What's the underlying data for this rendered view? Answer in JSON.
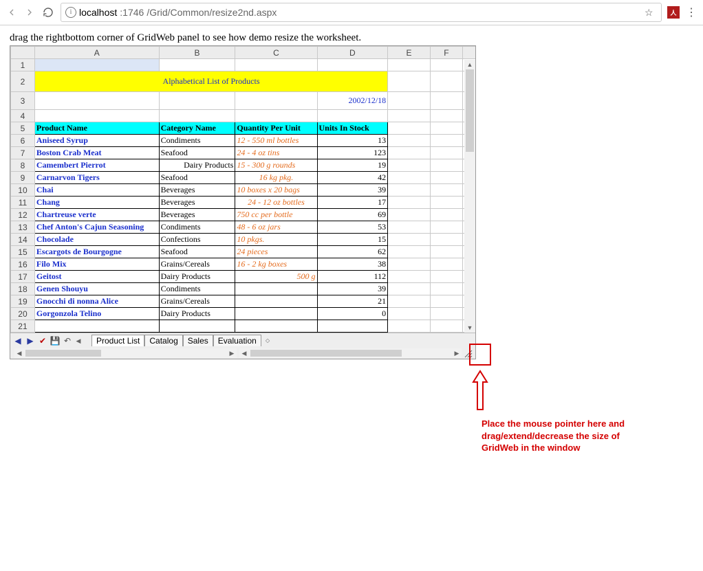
{
  "browser": {
    "url_host": "localhost",
    "url_port": ":1746",
    "url_path": "/Grid/Common/resize2nd.aspx",
    "pdf_label": "人"
  },
  "intro": "drag the rightbottom corner of GridWeb panel to see how demo resize the worksheet.",
  "cols": [
    "A",
    "B",
    "C",
    "D",
    "E",
    "F"
  ],
  "rows": [
    "1",
    "2",
    "3",
    "4",
    "5",
    "6",
    "7",
    "8",
    "9",
    "10",
    "11",
    "12",
    "13",
    "14",
    "15",
    "16",
    "17",
    "18",
    "19",
    "20",
    "21"
  ],
  "title": "Alphabetical List of Products",
  "date": "2002/12/18",
  "headers": {
    "p": "Product Name",
    "c": "Category Name",
    "q": "Quantity Per Unit",
    "s": "Units In Stock"
  },
  "data": [
    {
      "p": "Aniseed Syrup",
      "c": "Condiments",
      "q": "12 - 550 ml bottles",
      "s": "13",
      "qa": ""
    },
    {
      "p": "Boston Crab Meat",
      "c": "Seafood",
      "q": "24 - 4 oz tins",
      "s": "123",
      "qa": ""
    },
    {
      "p": "Camembert Pierrot",
      "c": "Dairy Products",
      "q": "15 - 300 g rounds",
      "s": "19",
      "qa": "",
      "cr": "right"
    },
    {
      "p": "Carnarvon Tigers",
      "c": "Seafood",
      "q": "16 kg pkg.",
      "s": "42",
      "qa": "center"
    },
    {
      "p": "Chai",
      "c": "Beverages",
      "q": "10 boxes x 20 bags",
      "s": "39",
      "qa": ""
    },
    {
      "p": "Chang",
      "c": "Beverages",
      "q": "24 - 12 oz bottles",
      "s": "17",
      "qa": "center"
    },
    {
      "p": "Chartreuse verte",
      "c": "Beverages",
      "q": "750 cc per bottle",
      "s": "69",
      "qa": ""
    },
    {
      "p": "Chef Anton's Cajun Seasoning",
      "c": "Condiments",
      "q": "48 - 6 oz jars",
      "s": "53",
      "qa": ""
    },
    {
      "p": "Chocolade",
      "c": "Confections",
      "q": "10 pkgs.",
      "s": "15",
      "qa": ""
    },
    {
      "p": "Escargots de Bourgogne",
      "c": "Seafood",
      "q": "24 pieces",
      "s": "62",
      "qa": ""
    },
    {
      "p": "Filo Mix",
      "c": "Grains/Cereals",
      "q": "16 - 2 kg boxes",
      "s": "38",
      "qa": ""
    },
    {
      "p": "Geitost",
      "c": "Dairy Products",
      "q": "500 g",
      "s": "112",
      "qa": "right"
    },
    {
      "p": "Genen Shouyu",
      "c": "Condiments",
      "q": "",
      "s": "39",
      "qa": ""
    },
    {
      "p": "Gnocchi di nonna Alice",
      "c": "Grains/Cereals",
      "q": "",
      "s": "21",
      "qa": ""
    },
    {
      "p": "Gorgonzola Telino",
      "c": "Dairy Products",
      "q": "",
      "s": "0",
      "qa": ""
    }
  ],
  "partial": {
    "p": "",
    "c": "",
    "q": "",
    "s": ""
  },
  "tabs": [
    "Product List",
    "Catalog",
    "Sales",
    "Evaluation"
  ],
  "annotation": "Place the mouse pointer here and drag/extend/decrease the size of GridWeb in the window"
}
